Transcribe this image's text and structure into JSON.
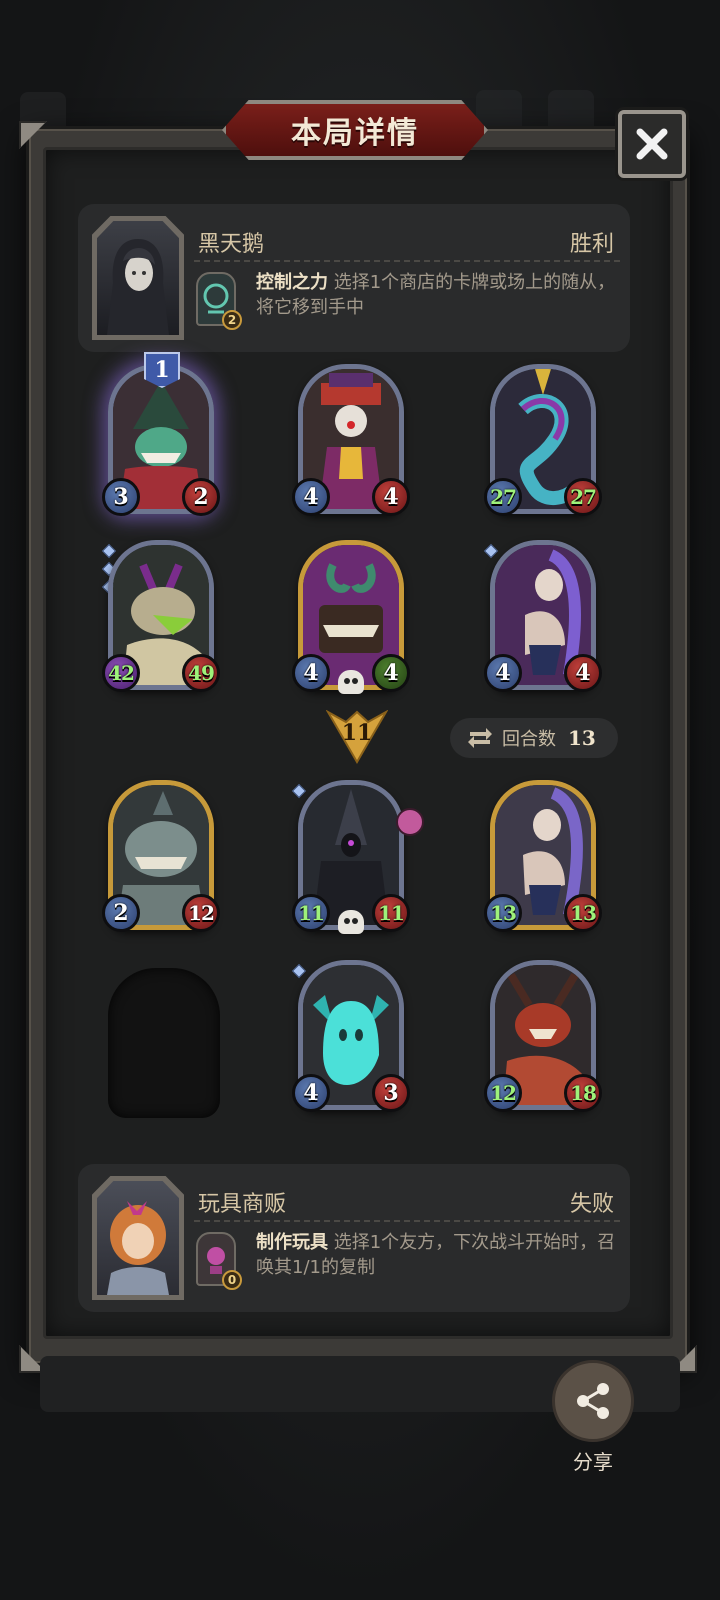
{
  "header": {
    "title": "本局详情"
  },
  "top_player": {
    "name": "黑天鹅",
    "result": "胜利",
    "skill": {
      "name": "控制之力",
      "description": "选择1个商店的卡牌或场上的随从，将它移到手中",
      "cost": "2"
    }
  },
  "top_board": [
    {
      "attack": "3",
      "health": "2",
      "rank": "1"
    },
    {
      "attack": "4",
      "health": "4"
    },
    {
      "attack": "27",
      "health": "27"
    },
    {
      "attack": "42",
      "health": "49"
    },
    {
      "attack": "4",
      "health": "4"
    },
    {
      "attack": "4",
      "health": "4"
    }
  ],
  "turn_marker": "11",
  "round_info": {
    "label": "回合数",
    "value": "13"
  },
  "bottom_board": [
    {
      "attack": "2",
      "health": "12"
    },
    {
      "attack": "11",
      "health": "11"
    },
    {
      "attack": "13",
      "health": "13"
    },
    {
      "attack": "4",
      "health": "3"
    },
    {
      "attack": "12",
      "health": "18"
    }
  ],
  "bottom_player": {
    "name": "玩具商贩",
    "result": "失败",
    "skill": {
      "name": "制作玩具",
      "description": "选择1个友方，下次战斗开始时，召唤其1/1的复制",
      "cost": "0"
    }
  },
  "share": {
    "label": "分享"
  },
  "colors": {
    "frame": "#3c3a37",
    "title_red": "#7a1f1a",
    "gold_frame": "#c79a3a",
    "attack_blue": "#2c3f6e",
    "health_red": "#6a1516"
  },
  "icons": [
    "close-icon",
    "refresh-icon",
    "share-icon",
    "skull-icon"
  ]
}
